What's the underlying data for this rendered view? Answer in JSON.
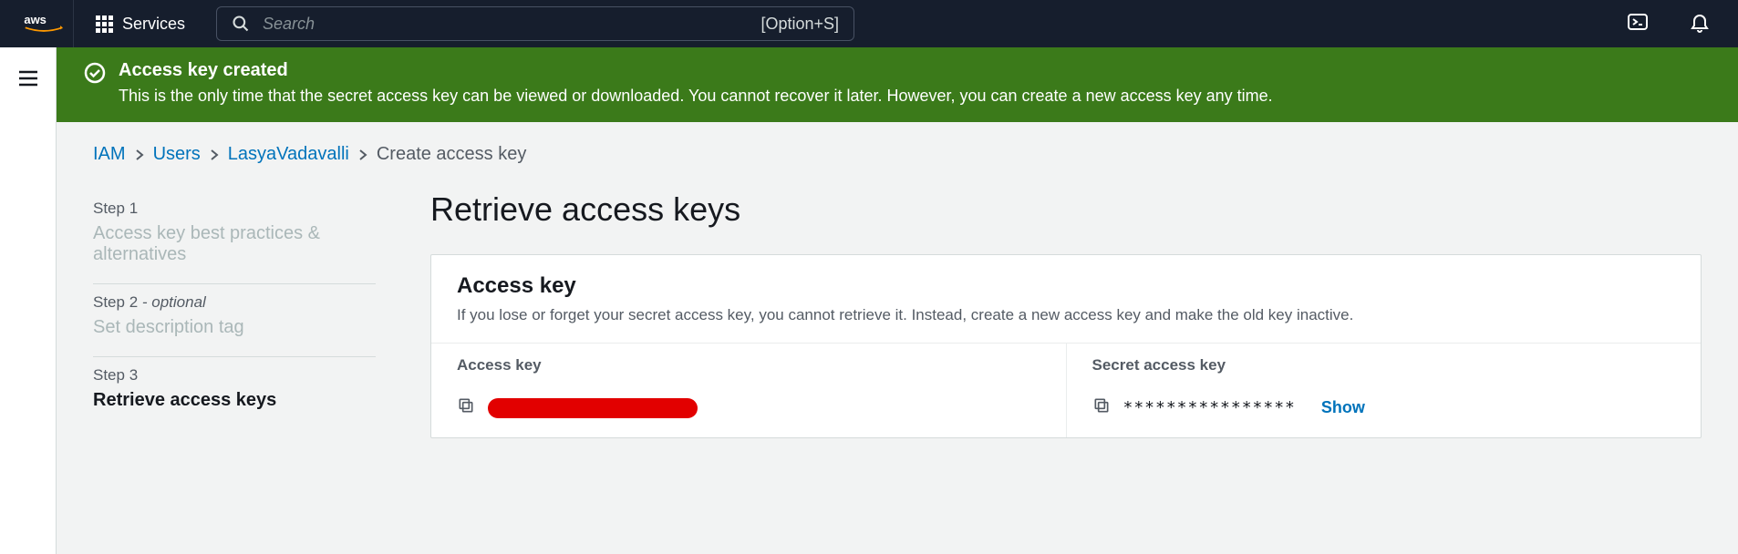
{
  "nav": {
    "services_label": "Services",
    "search_placeholder": "Search",
    "search_shortcut": "[Option+S]"
  },
  "banner": {
    "title": "Access key created",
    "message": "This is the only time that the secret access key can be viewed or downloaded. You cannot recover it later. However, you can create a new access key any time."
  },
  "breadcrumbs": {
    "items": [
      "IAM",
      "Users",
      "LasyaVadavalli",
      "Create access key"
    ]
  },
  "steps": [
    {
      "label": "Step 1",
      "optional": "",
      "name": "Access key best practices & alternatives",
      "state": "done"
    },
    {
      "label": "Step 2",
      "optional": " - optional",
      "name": "Set description tag",
      "state": "done"
    },
    {
      "label": "Step 3",
      "optional": "",
      "name": "Retrieve access keys",
      "state": "active"
    }
  ],
  "page": {
    "title": "Retrieve access keys"
  },
  "card": {
    "title": "Access key",
    "description": "If you lose or forget your secret access key, you cannot retrieve it. Instead, create a new access key and make the old key inactive.",
    "col1": "Access key",
    "col2": "Secret access key",
    "access_key_value": "",
    "secret_masked": "****************",
    "show_label": "Show"
  }
}
